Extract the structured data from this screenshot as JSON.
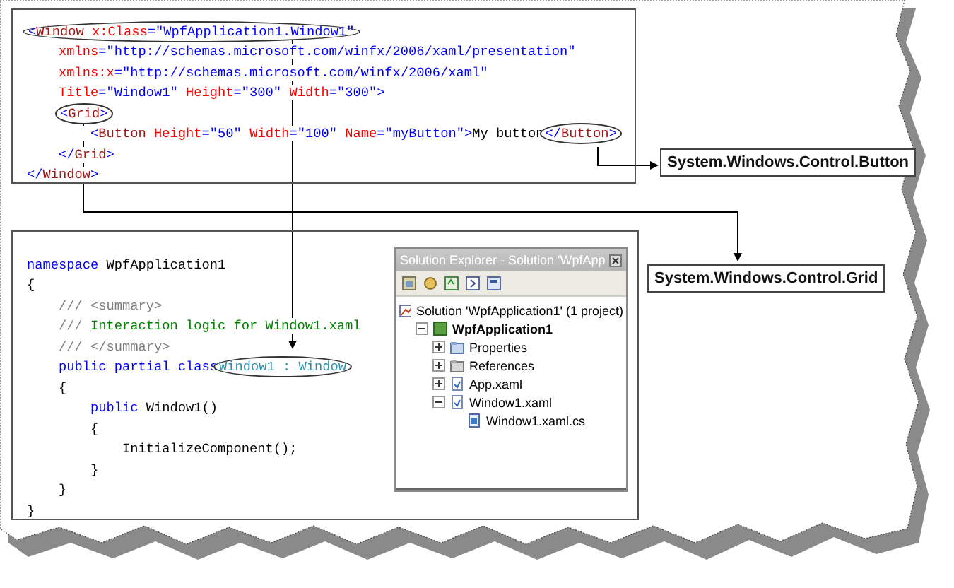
{
  "xaml_code": {
    "lines": [
      [
        {
          "circled": true,
          "tokens": [
            {
              "text": "<",
              "kind": "punct"
            },
            {
              "text": "Window",
              "kind": "element"
            },
            {
              "text": " x:Class",
              "kind": "attr"
            },
            {
              "text": "=\"WpfApplication1.Window1\"",
              "kind": "value"
            }
          ]
        }
      ],
      [
        {
          "circled": false,
          "tokens": [
            {
              "text": "    xmlns",
              "kind": "attr"
            },
            {
              "text": "=\"http://schemas.microsoft.com/winfx/2006/xaml/presentation\"",
              "kind": "value"
            }
          ]
        }
      ],
      [
        {
          "circled": false,
          "tokens": [
            {
              "text": "    xmlns:x",
              "kind": "attr"
            },
            {
              "text": "=\"http://schemas.microsoft.com/winfx/2006/xaml\"",
              "kind": "value"
            }
          ]
        }
      ],
      [
        {
          "circled": false,
          "tokens": [
            {
              "text": "    Title",
              "kind": "attr"
            },
            {
              "text": "=\"Window1\"",
              "kind": "value"
            },
            {
              "text": " Height",
              "kind": "attr"
            },
            {
              "text": "=\"300\"",
              "kind": "value"
            },
            {
              "text": " Width",
              "kind": "attr"
            },
            {
              "text": "=\"300\"",
              "kind": "value"
            },
            {
              "text": ">",
              "kind": "punct"
            }
          ]
        }
      ],
      [
        {
          "circled": true,
          "tokens": [
            {
              "text": "    <",
              "kind": "punct"
            },
            {
              "text": "Grid",
              "kind": "element"
            },
            {
              "text": ">",
              "kind": "punct"
            }
          ]
        }
      ],
      [
        {
          "circled": false,
          "tokens": [
            {
              "text": "        <",
              "kind": "punct"
            },
            {
              "text": "Button",
              "kind": "element"
            },
            {
              "text": " Height",
              "kind": "attr"
            },
            {
              "text": "=\"50\"",
              "kind": "value"
            },
            {
              "text": " Width",
              "kind": "attr"
            },
            {
              "text": "=\"100\"",
              "kind": "value"
            },
            {
              "text": " Name",
              "kind": "attr"
            },
            {
              "text": "=\"myButton\"",
              "kind": "value"
            },
            {
              "text": ">",
              "kind": "punct"
            },
            {
              "text": "My button",
              "kind": "plain"
            }
          ]
        },
        {
          "circled": true,
          "tokens": [
            {
              "text": "</",
              "kind": "punct"
            },
            {
              "text": "Button",
              "kind": "element"
            },
            {
              "text": ">",
              "kind": "punct"
            }
          ]
        }
      ],
      [
        {
          "circled": false,
          "tokens": [
            {
              "text": "    </",
              "kind": "punct"
            },
            {
              "text": "Grid",
              "kind": "element"
            },
            {
              "text": ">",
              "kind": "punct"
            }
          ]
        }
      ],
      [
        {
          "circled": false,
          "tokens": [
            {
              "text": "</",
              "kind": "punct"
            },
            {
              "text": "Window",
              "kind": "element"
            },
            {
              "text": ">",
              "kind": "punct"
            }
          ]
        }
      ]
    ]
  },
  "csharp_code": {
    "lines": [
      [
        {
          "circled": false,
          "tokens": [
            {
              "text": "namespace",
              "kind": "keyword"
            },
            {
              "text": " WpfApplication1",
              "kind": "plain"
            }
          ]
        }
      ],
      [
        {
          "circled": false,
          "tokens": [
            {
              "text": "{",
              "kind": "plain"
            }
          ]
        }
      ],
      [
        {
          "circled": false,
          "tokens": [
            {
              "text": "    /// <summary>",
              "kind": "doc"
            }
          ]
        }
      ],
      [
        {
          "circled": false,
          "tokens": [
            {
              "text": "    ///",
              "kind": "doc"
            },
            {
              "text": " Interaction logic for Window1.xaml",
              "kind": "comment"
            }
          ]
        }
      ],
      [
        {
          "circled": false,
          "tokens": [
            {
              "text": "    /// </summary>",
              "kind": "doc"
            }
          ]
        }
      ],
      [
        {
          "circled": false,
          "tokens": [
            {
              "text": "    public partial class",
              "kind": "keyword"
            }
          ]
        },
        {
          "circled": true,
          "tokens": [
            {
              "text": "Window1 : Window",
              "kind": "type"
            }
          ]
        }
      ],
      [
        {
          "circled": false,
          "tokens": [
            {
              "text": "    {",
              "kind": "plain"
            }
          ]
        }
      ],
      [
        {
          "circled": false,
          "tokens": [
            {
              "text": "        public",
              "kind": "keyword"
            },
            {
              "text": " Window1()",
              "kind": "plain"
            }
          ]
        }
      ],
      [
        {
          "circled": false,
          "tokens": [
            {
              "text": "        {",
              "kind": "plain"
            }
          ]
        }
      ],
      [
        {
          "circled": false,
          "tokens": [
            {
              "text": "            InitializeComponent();",
              "kind": "plain"
            }
          ]
        }
      ],
      [
        {
          "circled": false,
          "tokens": [
            {
              "text": "        }",
              "kind": "plain"
            }
          ]
        }
      ],
      [
        {
          "circled": false,
          "tokens": [
            {
              "text": "    }",
              "kind": "plain"
            }
          ]
        }
      ],
      [
        {
          "circled": false,
          "tokens": [
            {
              "text": "}",
              "kind": "plain"
            }
          ]
        }
      ]
    ]
  },
  "labels": [
    {
      "text": "System.Windows.Control.Button",
      "kind": "button"
    },
    {
      "text": "System.Windows.Control.Grid",
      "kind": "grid"
    }
  ],
  "solution_explorer": {
    "title": "Solution Explorer - Solution 'WpfApp",
    "tree": [
      {
        "label": "Solution 'WpfApplication1' (1 project)",
        "kind": "solution",
        "children": [
          {
            "label": "WpfApplication1",
            "kind": "project",
            "expanded": true,
            "children": [
              {
                "label": "Properties",
                "kind": "properties",
                "expanded": false
              },
              {
                "label": "References",
                "kind": "references",
                "expanded": false
              },
              {
                "label": "App.xaml",
                "kind": "xaml",
                "expanded": false
              },
              {
                "label": "Window1.xaml",
                "kind": "xaml",
                "expanded": true,
                "children": [
                  {
                    "label": "Window1.xaml.cs",
                    "kind": "cs"
                  }
                ]
              }
            ]
          }
        ]
      }
    ]
  }
}
